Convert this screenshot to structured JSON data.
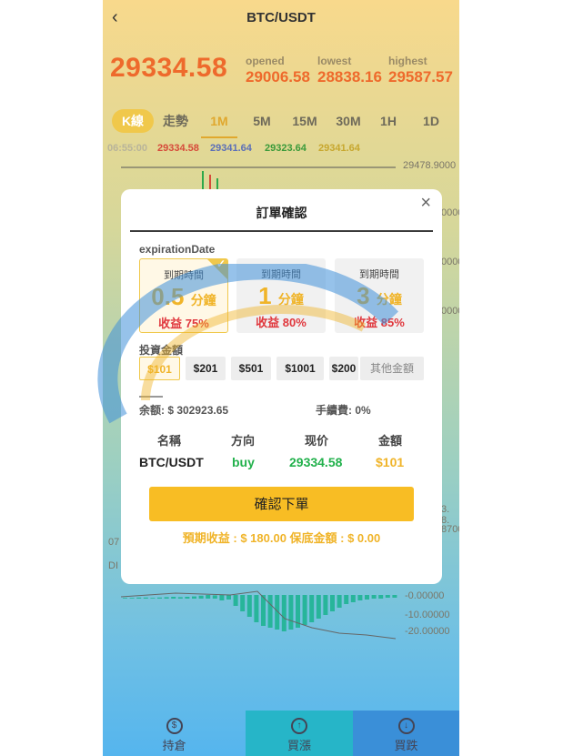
{
  "header": {
    "title": "BTC/USDT",
    "back_icon": "‹"
  },
  "price": {
    "current": "29334.58",
    "opened_label": "opened",
    "opened": "29006.58",
    "lowest_label": "lowest",
    "lowest": "28838.16",
    "highest_label": "highest",
    "highest": "29587.57"
  },
  "tabs": [
    {
      "label": "K線"
    },
    {
      "label": "走勢"
    },
    {
      "label": "1M"
    },
    {
      "label": "5M"
    },
    {
      "label": "15M"
    },
    {
      "label": "30M"
    },
    {
      "label": "1H"
    },
    {
      "label": "1D"
    }
  ],
  "ohlc": {
    "time": "06:55:00",
    "v1": "29334.58",
    "v2": "29341.64",
    "v3": "29323.64",
    "v4": "29341.64"
  },
  "chart_axis": {
    "top": "29478.9000",
    "r1": "00000",
    "r2": "00000",
    "r3": "00000",
    "low1": "3.",
    "low2": "8.",
    "low3": "8700",
    "left1": "07",
    "left2": "DI",
    "m1": "-0.00000",
    "m2": "-10.00000",
    "m3": "-20.00000"
  },
  "modal": {
    "title": "訂單確認",
    "close_icon": "×",
    "expiration_label": "expirationDate",
    "options": [
      {
        "label": "到期時間",
        "value": "0.5",
        "unit": "分鐘",
        "yield_label": "收益",
        "yield": "75%"
      },
      {
        "label": "到期時間",
        "value": "1",
        "unit": "分鐘",
        "yield_label": "收益",
        "yield": "80%"
      },
      {
        "label": "到期時間",
        "value": "3",
        "unit": "分鐘",
        "yield_label": "收益",
        "yield": "85%"
      }
    ],
    "invest_label": "投資金額",
    "amounts": [
      "$101",
      "$201",
      "$501",
      "$1001",
      "$200"
    ],
    "other_amount": "其他金額",
    "balance": "余额: $ 302923.65",
    "fee": "手續費:  0%",
    "headers": {
      "name": "名稱",
      "direction": "方向",
      "price": "现价",
      "amount": "金額"
    },
    "row": {
      "name": "BTC/USDT",
      "direction": "buy",
      "price": "29334.58",
      "amount": "$101"
    },
    "confirm_label": "確認下單",
    "expected": "預期收益 : $ 180.00    保底金額 : $ 0.00"
  },
  "bottom_nav": [
    {
      "label": "持倉"
    },
    {
      "label": "買漲"
    },
    {
      "label": "買跌"
    }
  ],
  "colors": {
    "accent": "#f0b429",
    "price": "#ee6a2c",
    "red": "#e0373d",
    "green": "#22b14c"
  }
}
